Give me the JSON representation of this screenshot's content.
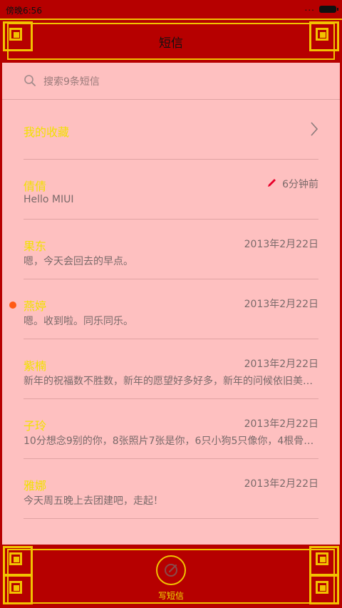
{
  "status_bar": {
    "time": "傍晚6:56",
    "signal_dots": "..."
  },
  "header": {
    "title": "短信"
  },
  "search": {
    "placeholder": "搜索9条短信"
  },
  "favorites": {
    "label": "我的收藏"
  },
  "conversations": [
    {
      "name": "倩倩",
      "time": "6分钟前",
      "message": "Hello MIUI",
      "draft": true,
      "unread": false
    },
    {
      "name": "果东",
      "time": "2013年2月22日",
      "message": "嗯，今天会回去的早点。",
      "draft": false,
      "unread": false
    },
    {
      "name": "燕婷",
      "time": "2013年2月22日",
      "message": "嗯。收到啦。同乐同乐。",
      "draft": false,
      "unread": true
    },
    {
      "name": "紫楠",
      "time": "2013年2月22日",
      "message": "新年的祝福数不胜数，新年的愿望好多好多，新年的问候依旧美…",
      "draft": false,
      "unread": false
    },
    {
      "name": "子玲",
      "time": "2013年2月22日",
      "message": "10分想念9别的你，8张照片7张是你，6只小狗5只像你，4根骨…",
      "draft": false,
      "unread": false
    },
    {
      "name": "雅娜",
      "time": "2013年2月22日",
      "message": "今天周五晚上去团建吧，走起！",
      "draft": false,
      "unread": false
    }
  ],
  "bottom_bar": {
    "compose_label": "写短信"
  },
  "colors": {
    "background": "#b60000",
    "gold": "#f2c200",
    "name_yellow": "#f2e000",
    "content_pink": "#fec0c0",
    "unread_dot": "#ff5a14",
    "draft_pencil": "#e8002a"
  }
}
